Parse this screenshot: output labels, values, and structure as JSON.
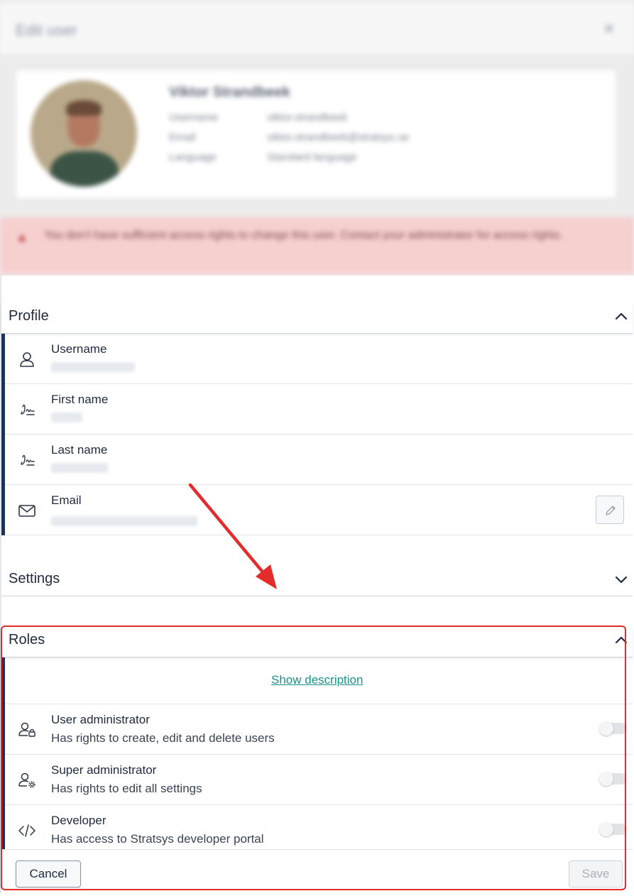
{
  "dialog": {
    "title": "Edit user",
    "close_icon": "close-icon"
  },
  "profile_card": {
    "name": "Viktor Strandbeek",
    "rows": [
      {
        "label": "Username",
        "value": "viktor.strandbeek"
      },
      {
        "label": "Email",
        "value": "viktor.strandbeek@stratsys.se"
      },
      {
        "label": "Language",
        "value": "Standard language"
      }
    ]
  },
  "alert": {
    "text": "You don't have sufficient access rights to change this user. Contact your administrator for access rights."
  },
  "sections": {
    "profile": {
      "label": "Profile",
      "expanded": true,
      "fields": [
        {
          "icon": "user-icon",
          "label": "Username"
        },
        {
          "icon": "signature-icon",
          "label": "First name"
        },
        {
          "icon": "signature-icon",
          "label": "Last name"
        },
        {
          "icon": "envelope-icon",
          "label": "Email"
        }
      ]
    },
    "settings": {
      "label": "Settings",
      "expanded": false
    },
    "roles": {
      "label": "Roles",
      "expanded": true,
      "show_description": "Show description",
      "items": [
        {
          "icon": "user-lock-icon",
          "title": "User administrator",
          "description": "Has rights to create, edit and delete users",
          "enabled": false
        },
        {
          "icon": "user-gear-icon",
          "title": "Super administrator",
          "description": "Has rights to edit all settings",
          "enabled": false
        },
        {
          "icon": "code-icon",
          "title": "Developer",
          "description": "Has access to Stratsys developer portal",
          "enabled": false
        }
      ]
    }
  },
  "footer": {
    "cancel_label": "Cancel",
    "save_label": "Save"
  },
  "colors": {
    "accent_bar": "#1f3354",
    "link": "#1d8f8a",
    "alert_bg": "#f6cfcf",
    "annotation_red": "#e52c2c"
  }
}
